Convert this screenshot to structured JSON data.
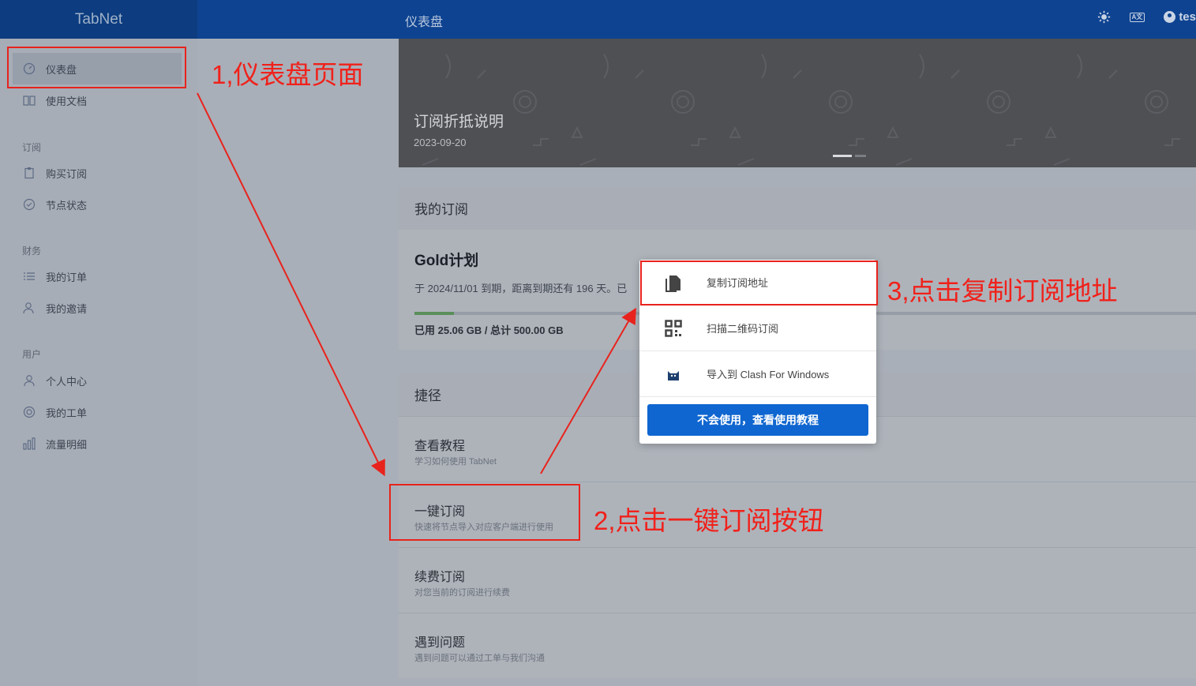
{
  "brand": "TabNet",
  "header": {
    "title": "仪表盘",
    "user_label": "tes",
    "theme_icon": "sun-icon",
    "lang_icon": "translate-icon"
  },
  "sidebar": {
    "items_top": [
      {
        "label": "仪表盘",
        "icon": "dashboard-icon",
        "active": true
      },
      {
        "label": "使用文档",
        "icon": "book-icon"
      }
    ],
    "groups": [
      {
        "heading": "订阅",
        "items": [
          {
            "label": "购买订阅",
            "icon": "clipboard-icon"
          },
          {
            "label": "节点状态",
            "icon": "check-circle-icon"
          }
        ]
      },
      {
        "heading": "财务",
        "items": [
          {
            "label": "我的订单",
            "icon": "list-icon"
          },
          {
            "label": "我的邀请",
            "icon": "users-icon"
          }
        ]
      },
      {
        "heading": "用户",
        "items": [
          {
            "label": "个人中心",
            "icon": "user-icon"
          },
          {
            "label": "我的工单",
            "icon": "support-icon"
          },
          {
            "label": "流量明细",
            "icon": "bar-chart-icon"
          }
        ]
      }
    ]
  },
  "banner": {
    "title": "订阅折抵说明",
    "date": "2023-09-20"
  },
  "subscription": {
    "heading": "我的订阅",
    "plan": "Gold计划",
    "expiry": "于 2024/11/01 到期，距离到期还有 196 天。已",
    "usage_fraction": 0.05,
    "usage": "已用 25.06 GB / 总计 500.00 GB"
  },
  "shortcuts": {
    "heading": "捷径",
    "items": [
      {
        "title": "查看教程",
        "desc": "学习如何使用 TabNet"
      },
      {
        "title": "一键订阅",
        "desc": "快速将节点导入对应客户端进行使用"
      },
      {
        "title": "续费订阅",
        "desc": "对您当前的订阅进行续费"
      },
      {
        "title": "遇到问题",
        "desc": "遇到问题可以通过工单与我们沟通"
      }
    ]
  },
  "popup": {
    "items": [
      {
        "label": "复制订阅地址",
        "icon": "copy-icon"
      },
      {
        "label": "扫描二维码订阅",
        "icon": "qrcode-icon"
      },
      {
        "label": "导入到 Clash For Windows",
        "icon": "clash-cat-icon"
      }
    ],
    "button": "不会使用，查看使用教程"
  },
  "annotations": {
    "step1": "1,仪表盘页面",
    "step2": "2,点击一键订阅按钮",
    "step3": "3,点击复制订阅地址",
    "color": "#e8231d"
  },
  "colors": {
    "topbar": "#0e4391",
    "primary_button": "#0f66d0"
  }
}
